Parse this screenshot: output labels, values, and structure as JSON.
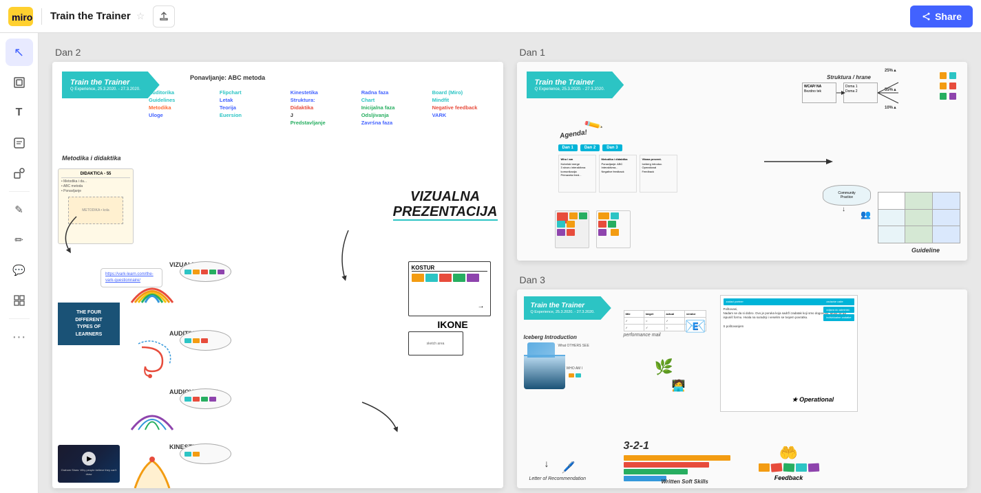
{
  "app": {
    "logo_text": "miro",
    "title": "Train the Trainer",
    "share_label": "Share"
  },
  "toolbar": {
    "tools": [
      {
        "id": "select",
        "icon": "↖",
        "label": "Select tool",
        "active": true
      },
      {
        "id": "frames",
        "icon": "▣",
        "label": "Frames tool"
      },
      {
        "id": "text",
        "icon": "T",
        "label": "Text tool"
      },
      {
        "id": "sticky",
        "icon": "▤",
        "label": "Sticky note tool"
      },
      {
        "id": "shape",
        "icon": "□",
        "label": "Shape tool"
      },
      {
        "id": "draw",
        "icon": "✏",
        "label": "Draw tool"
      },
      {
        "id": "pencil",
        "icon": "🖊",
        "label": "Pencil tool"
      },
      {
        "id": "comment",
        "icon": "💬",
        "label": "Comment tool"
      },
      {
        "id": "grid",
        "icon": "⊞",
        "label": "Grid tool"
      },
      {
        "id": "more",
        "icon": "⋯",
        "label": "More tools"
      }
    ]
  },
  "sections": [
    {
      "id": "dan1",
      "label": "Dan 1"
    },
    {
      "id": "dan2",
      "label": "Dan 2"
    },
    {
      "id": "dan3",
      "label": "Dan 3"
    }
  ],
  "dan1_board": {
    "title": "Train the Trainer",
    "subtitle": "Q Experience, 25.3.2020. - 27.3.2020.",
    "agenda_label": "Agenda!",
    "days": [
      "Dan 1",
      "Dan 2",
      "Dan 3"
    ],
    "guideline_label": "Guideline",
    "struktura_label": "Struktura / hrane"
  },
  "dan2_board": {
    "title": "Train the Trainer",
    "subtitle": "Q Experience, 25.3.2020. - 27.3.2020.",
    "ponavljanje_label": "Ponavljanje: ABC metoda",
    "metodika_label": "Metodika i didaktika",
    "keywords": [
      {
        "text": "Auditorika",
        "color": "teal"
      },
      {
        "text": "Flipchart",
        "color": "teal"
      },
      {
        "text": "Kinestetika",
        "color": "blue"
      },
      {
        "text": "Radna faza",
        "color": "blue"
      },
      {
        "text": "Board (Miro)",
        "color": "teal"
      },
      {
        "text": "Guidelines",
        "color": "teal"
      },
      {
        "text": "Letak",
        "color": "blue"
      },
      {
        "text": "Struktura:",
        "color": "blue"
      },
      {
        "text": "Chart",
        "color": "teal"
      },
      {
        "text": "Mindfit",
        "color": "teal"
      },
      {
        "text": "Metodika",
        "color": "orange"
      },
      {
        "text": "Teorija",
        "color": "blue"
      },
      {
        "text": "Didaktika",
        "color": "red"
      },
      {
        "text": "Inicijalna faza",
        "color": "green"
      },
      {
        "text": "Negative feedback",
        "color": "red"
      },
      {
        "text": "Uloge",
        "color": "blue"
      },
      {
        "text": "Euersion",
        "color": "teal"
      },
      {
        "text": "J",
        "color": "dark"
      },
      {
        "text": "Odsljivanja",
        "color": "green"
      },
      {
        "text": "VARK",
        "color": "blue"
      },
      {
        "text": "",
        "color": ""
      },
      {
        "text": "",
        "color": ""
      },
      {
        "text": "Predstavljanje",
        "color": "green"
      },
      {
        "text": "Zavrśna faza",
        "color": "blue"
      }
    ],
    "vizualna_text": "VIZUALNA\nPREZENTACIJA",
    "learner_types": [
      "VIZUALNI",
      "AUDITIVNI",
      "AUDIOVIZUALNI",
      "KINESTETI"
    ],
    "four_types_label": "THE FOUR DIFFERENT\nTYPES OF LEARNERS",
    "link_text": "https://vark-learn.com/the-vark-questionnaire/",
    "video_caption": "Graham Shaw: Why people believe they can't draw"
  },
  "dan3_board": {
    "title": "Train the Trainer",
    "subtitle": "Q Experience, 25.3.2020. - 27.3.2020.",
    "iceberg_label": "Iceberg Introduction",
    "what_others_see": "What OTHERS SEE",
    "who_am_i": "WHO AM I",
    "written_soft_skills": "Written Soft Skills",
    "letter_label": "Letter of Recommendation",
    "performance_label": "performance mail",
    "operational_label": "★ Operational",
    "feedback_label": "Feedback",
    "321_label": "3-2-1"
  }
}
